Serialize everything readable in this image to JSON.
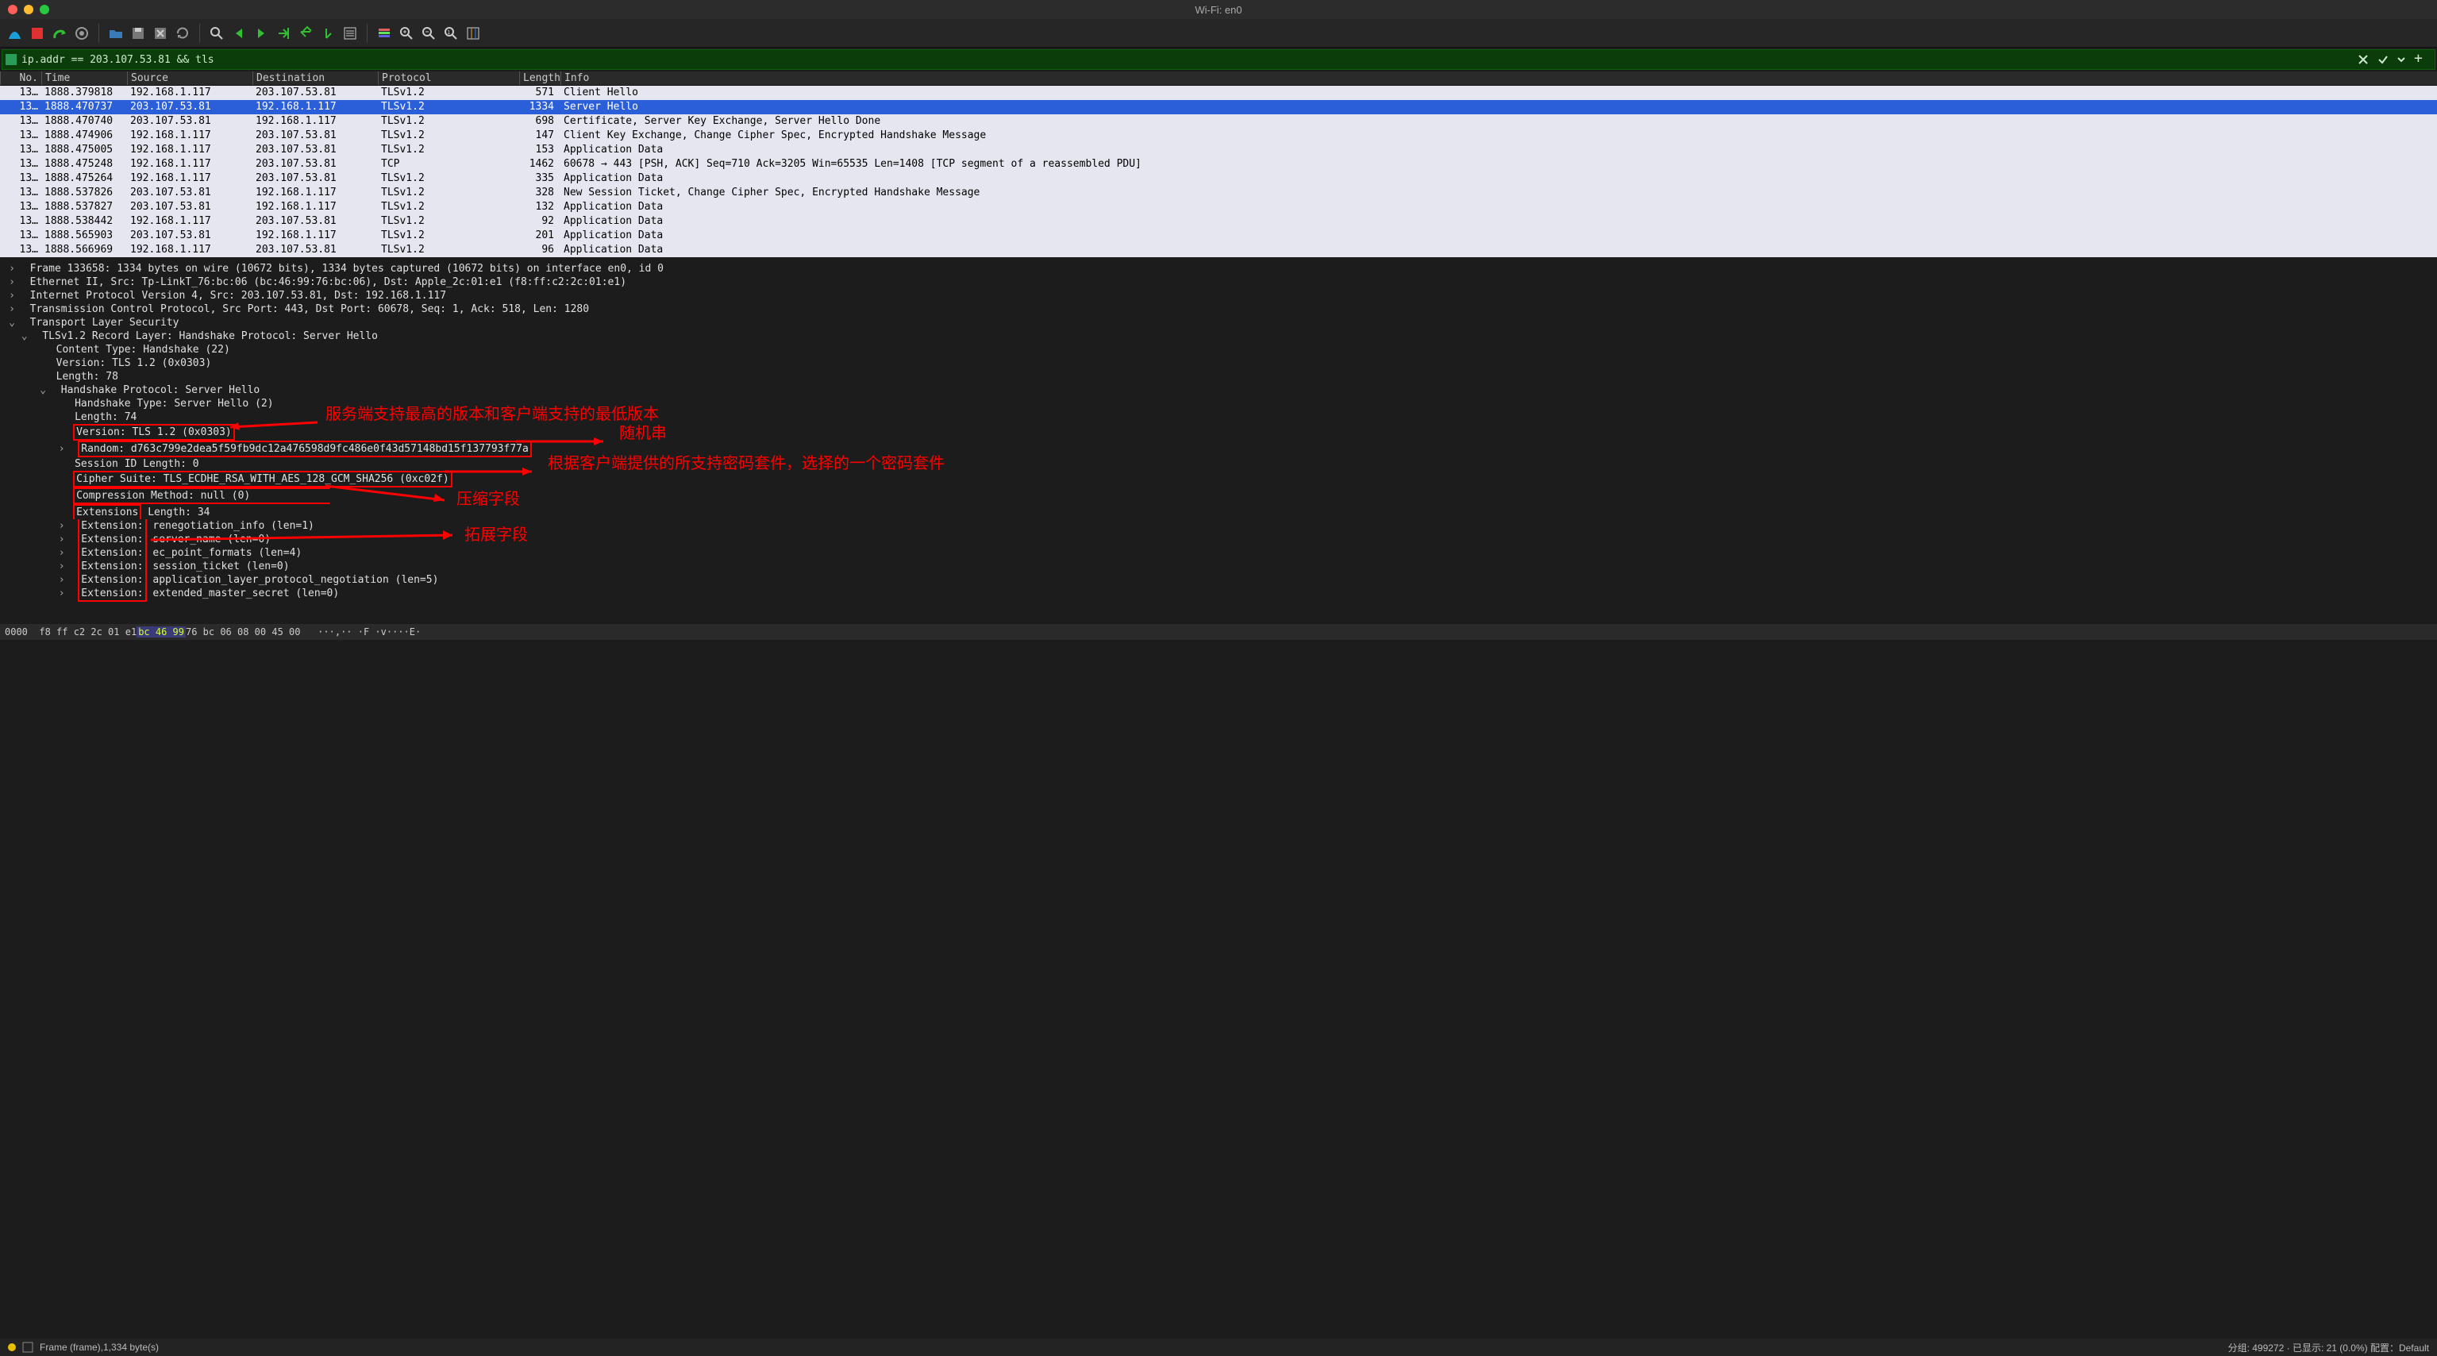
{
  "window": {
    "title": "Wi-Fi: en0"
  },
  "filter": {
    "value": "ip.addr == 203.107.53.81 && tls"
  },
  "columns": {
    "no": "No.",
    "time": "Time",
    "src": "Source",
    "dst": "Destination",
    "proto": "Protocol",
    "len": "Length",
    "info": "Info"
  },
  "packets": [
    {
      "no": "13…",
      "time": "1888.379818",
      "src": "192.168.1.117",
      "dst": "203.107.53.81",
      "proto": "TLSv1.2",
      "len": "571",
      "info": "Client Hello",
      "sel": false
    },
    {
      "no": "13…",
      "time": "1888.470737",
      "src": "203.107.53.81",
      "dst": "192.168.1.117",
      "proto": "TLSv1.2",
      "len": "1334",
      "info": "Server Hello",
      "sel": true
    },
    {
      "no": "13…",
      "time": "1888.470740",
      "src": "203.107.53.81",
      "dst": "192.168.1.117",
      "proto": "TLSv1.2",
      "len": "698",
      "info": "Certificate, Server Key Exchange, Server Hello Done",
      "sel": false
    },
    {
      "no": "13…",
      "time": "1888.474906",
      "src": "192.168.1.117",
      "dst": "203.107.53.81",
      "proto": "TLSv1.2",
      "len": "147",
      "info": "Client Key Exchange, Change Cipher Spec, Encrypted Handshake Message",
      "sel": false
    },
    {
      "no": "13…",
      "time": "1888.475005",
      "src": "192.168.1.117",
      "dst": "203.107.53.81",
      "proto": "TLSv1.2",
      "len": "153",
      "info": "Application Data",
      "sel": false
    },
    {
      "no": "13…",
      "time": "1888.475248",
      "src": "192.168.1.117",
      "dst": "203.107.53.81",
      "proto": "TCP",
      "len": "1462",
      "info": "60678 → 443 [PSH, ACK] Seq=710 Ack=3205 Win=65535 Len=1408 [TCP segment of a reassembled PDU]",
      "sel": false
    },
    {
      "no": "13…",
      "time": "1888.475264",
      "src": "192.168.1.117",
      "dst": "203.107.53.81",
      "proto": "TLSv1.2",
      "len": "335",
      "info": "Application Data",
      "sel": false
    },
    {
      "no": "13…",
      "time": "1888.537826",
      "src": "203.107.53.81",
      "dst": "192.168.1.117",
      "proto": "TLSv1.2",
      "len": "328",
      "info": "New Session Ticket, Change Cipher Spec, Encrypted Handshake Message",
      "sel": false
    },
    {
      "no": "13…",
      "time": "1888.537827",
      "src": "203.107.53.81",
      "dst": "192.168.1.117",
      "proto": "TLSv1.2",
      "len": "132",
      "info": "Application Data",
      "sel": false
    },
    {
      "no": "13…",
      "time": "1888.538442",
      "src": "192.168.1.117",
      "dst": "203.107.53.81",
      "proto": "TLSv1.2",
      "len": "92",
      "info": "Application Data",
      "sel": false
    },
    {
      "no": "13…",
      "time": "1888.565903",
      "src": "203.107.53.81",
      "dst": "192.168.1.117",
      "proto": "TLSv1.2",
      "len": "201",
      "info": "Application Data",
      "sel": false
    },
    {
      "no": "13…",
      "time": "1888.566969",
      "src": "192.168.1.117",
      "dst": "203.107.53.81",
      "proto": "TLSv1.2",
      "len": "96",
      "info": "Application Data",
      "sel": false
    }
  ],
  "details": {
    "frame": "Frame 133658: 1334 bytes on wire (10672 bits), 1334 bytes captured (10672 bits) on interface en0, id 0",
    "eth": "Ethernet II, Src: Tp-LinkT_76:bc:06 (bc:46:99:76:bc:06), Dst: Apple_2c:01:e1 (f8:ff:c2:2c:01:e1)",
    "ip": "Internet Protocol Version 4, Src: 203.107.53.81, Dst: 192.168.1.117",
    "tcp": "Transmission Control Protocol, Src Port: 443, Dst Port: 60678, Seq: 1, Ack: 518, Len: 1280",
    "tls": "Transport Layer Security",
    "record": "TLSv1.2 Record Layer: Handshake Protocol: Server Hello",
    "content_type": "Content Type: Handshake (22)",
    "version1": "Version: TLS 1.2 (0x0303)",
    "len_record": "Length: 78",
    "hs": "Handshake Protocol: Server Hello",
    "hs_type": "Handshake Type: Server Hello (2)",
    "hs_len": "Length: 74",
    "hs_ver": "Version: TLS 1.2 (0x0303)",
    "random": "Random: d763c799e2dea5f59fb9dc12a476598d9fc486e0f43d57148bd15f137793f77a",
    "sid": "Session ID Length: 0",
    "cipher": "Cipher Suite: TLS_ECDHE_RSA_WITH_AES_128_GCM_SHA256 (0xc02f)",
    "comp": "Compression Method: null (0)",
    "ext_len": "Extensions Length: 34",
    "ext_prefix": "Extension:",
    "ext1": "renegotiation_info (len=1)",
    "ext2": "server_name (len=0)",
    "ext3": "ec_point_formats (len=4)",
    "ext4": "session_ticket (len=0)",
    "ext5": "application_layer_protocol_negotiation (len=5)",
    "ext6": "extended_master_secret (len=0)",
    "ext_left": "Extensions"
  },
  "annotations": {
    "a1": "服务端支持最高的版本和客户端支持的最低版本",
    "a2": "随机串",
    "a3": "根据客户端提供的所支持密码套件，选择的一个密码套件",
    "a4": "压缩字段",
    "a5": "拓展字段"
  },
  "hex": {
    "offset": "0000",
    "bytes_a": "f8 ff c2 2c 01 e1 ",
    "bytes_hl": "bc 46   99",
    "bytes_b": " 76 bc 06 08 00 45 00",
    "ascii": "···,·· ·F ·v····E·"
  },
  "status": {
    "frame": "Frame (frame),1,334 byte(s)",
    "right": "分组: 499272  ·  已显示: 21 (0.0%)      配置：Default"
  }
}
